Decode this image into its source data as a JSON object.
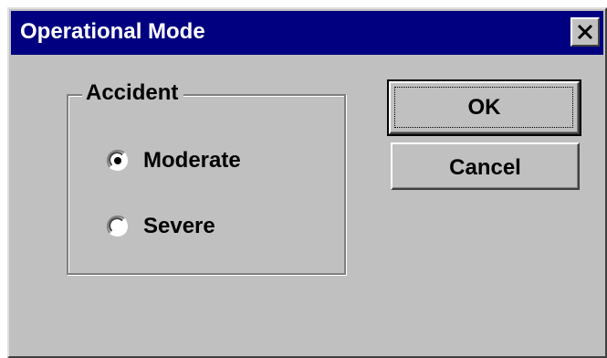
{
  "window": {
    "title": "Operational Mode",
    "close_icon": "close-icon"
  },
  "group": {
    "label": "Accident",
    "options": [
      {
        "label": "Moderate",
        "selected": true
      },
      {
        "label": "Severe",
        "selected": false
      }
    ]
  },
  "buttons": {
    "ok_label": "OK",
    "cancel_label": "Cancel"
  },
  "colors": {
    "titlebar": "#000080",
    "face": "#c0c0c0"
  }
}
